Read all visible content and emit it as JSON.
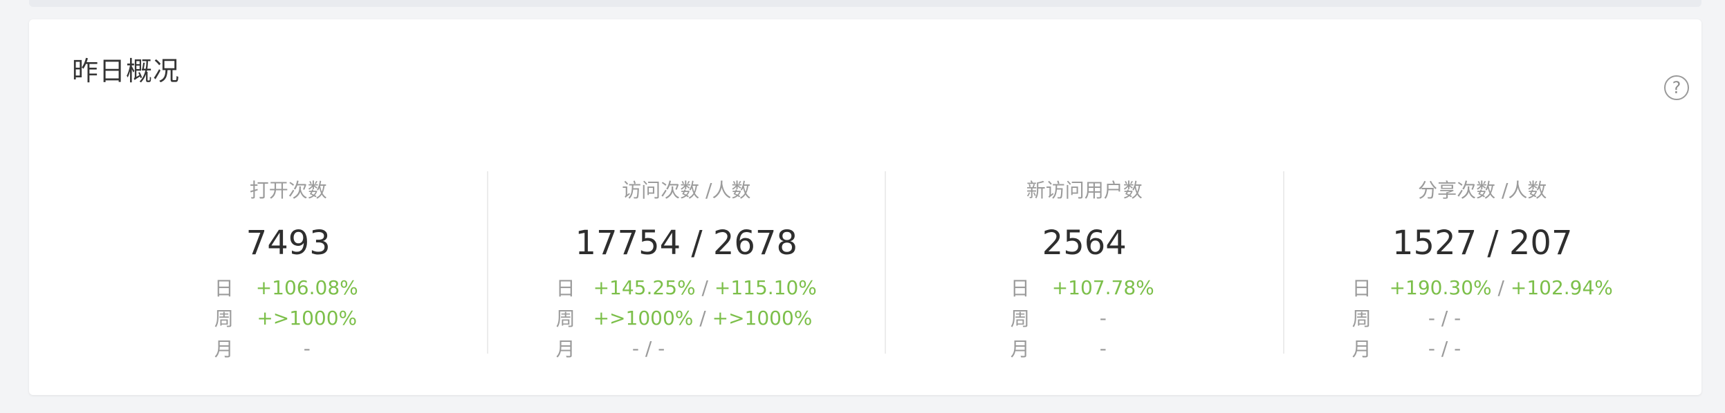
{
  "card": {
    "title": "昨日概况",
    "help_icon_glyph": "?"
  },
  "colors": {
    "positive": "#7cbf4a",
    "muted": "#9b9b9b",
    "value": "#2e2e2e"
  },
  "stats": [
    {
      "label": "打开次数",
      "value": "7493",
      "day": "+106.08%",
      "week": "+>1000%",
      "month": "-"
    },
    {
      "label": "访问次数 /人数",
      "value": "17754 / 2678",
      "day_a": "+145.25%",
      "day_b": "+115.10%",
      "week_a": "+>1000%",
      "week_b": "+>1000%",
      "month": "- / -"
    },
    {
      "label": "新访问用户数",
      "value": "2564",
      "day": "+107.78%",
      "week": "-",
      "month": "-"
    },
    {
      "label": "分享次数 /人数",
      "value": "1527 / 207",
      "day_a": "+190.30%",
      "day_b": "+102.94%",
      "week": "- / -",
      "month": "- / -"
    }
  ],
  "row_labels": {
    "day": "日",
    "week": "周",
    "month": "月"
  },
  "separator": "/"
}
